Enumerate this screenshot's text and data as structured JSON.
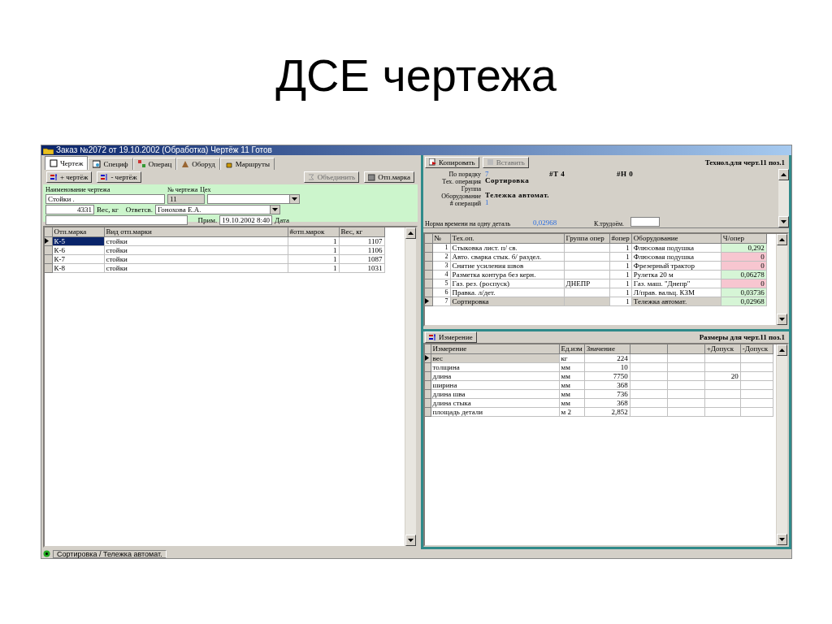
{
  "slide_title": "ДСЕ чертежа",
  "window": {
    "title": "Заказ №2072 от 19.10.2002 (Обработка) Чертёж 11 Готов"
  },
  "tabs": [
    {
      "label": "Чертеж",
      "selected": true
    },
    {
      "label": "Специф",
      "selected": false
    },
    {
      "label": "Операц",
      "selected": false
    },
    {
      "label": "Оборуд",
      "selected": false
    },
    {
      "label": "Маршруты",
      "selected": false
    }
  ],
  "left_toolbar": [
    {
      "label": "+ чертёж",
      "disabled": false
    },
    {
      "label": "- чертёж",
      "disabled": false
    },
    {
      "label": "Объединить",
      "disabled": true
    },
    {
      "label": "Отп.марка",
      "disabled": false
    }
  ],
  "drawing_form": {
    "name_label": "Наименование чертежа",
    "name_value": "Стойки .",
    "number_label": "№ чертежа",
    "number_value": "11",
    "shop_label": "Цех",
    "weight_value": "4331",
    "weight_label": "Вес, кг",
    "responsible_label": "Ответсв.",
    "responsible_value": "Гонохова Е.А.",
    "note_label": "Прим.",
    "date_value": "19.10.2002 8:40",
    "date_label": "Дата"
  },
  "marks_table": {
    "columns": [
      "Отп.марка",
      "Вид отп.марки",
      "#отп.марок",
      "Вес, кг"
    ],
    "rows": [
      {
        "cells": [
          "К-5",
          "стойки",
          "1",
          "1107"
        ],
        "selected": true
      },
      {
        "cells": [
          "К-6",
          "стойки",
          "1",
          "1106"
        ],
        "selected": false
      },
      {
        "cells": [
          "К-7",
          "стойки",
          "1",
          "1087"
        ],
        "selected": false
      },
      {
        "cells": [
          "К-8",
          "стойки",
          "1",
          "1031"
        ],
        "selected": false
      }
    ]
  },
  "right_toolbar": {
    "buttons": [
      {
        "label": "Копировать",
        "disabled": false
      },
      {
        "label": "Вставить",
        "disabled": true
      }
    ],
    "caption": "Технол.для черт.11 поз.1"
  },
  "operation_details": {
    "order_label": "По порядку",
    "order_value": "7",
    "t_label": "#Т",
    "t_value": "4",
    "h_label": "#Н",
    "h_value": "0",
    "op_label": "Тех. операция",
    "op_value": "Сортировка",
    "group_label": "Группа",
    "equipment_label": "Оборудование",
    "equipment_value": "Тележка автомат.",
    "count_label": "# операций",
    "count_value": "1",
    "norm_label": "Норма времени на одну деталь",
    "norm_value": "0,02968",
    "labor_label": "К.трудоём."
  },
  "operations_table": {
    "columns": [
      "№",
      "Тех.оп.",
      "Группа опер",
      "#опер",
      "Оборудование",
      "Ч/опер"
    ],
    "rows": [
      {
        "cells": [
          "1",
          "Стыковка лист.  п/ св.",
          "",
          "1",
          "Флюсовая подушка",
          "0,292"
        ],
        "color": "#d6f5d6",
        "selected": false
      },
      {
        "cells": [
          "2",
          "Авто. сварка стык. б/ раздел.",
          "",
          "1",
          "Флюсовая подушка",
          "0"
        ],
        "color": "#f7c6d0",
        "selected": false
      },
      {
        "cells": [
          "3",
          "Снятие усиления швов",
          "",
          "1",
          "Фрезерный трактор",
          "0"
        ],
        "color": "#f7c6d0",
        "selected": false
      },
      {
        "cells": [
          "4",
          "Разметка контура без керн.",
          "",
          "1",
          "Рулетка 20 м",
          "0,06278"
        ],
        "color": "#d6f5d6",
        "selected": false
      },
      {
        "cells": [
          "5",
          "Газ. рез. (роспуск)",
          "ДНЕПР",
          "1",
          "Газ. маш. \"Днепр\"",
          "0"
        ],
        "color": "#f7c6d0",
        "selected": false
      },
      {
        "cells": [
          "6",
          "Правка. л/дет.",
          "",
          "1",
          "Л/прав. вальц. КЗМ",
          "0,03736"
        ],
        "color": "#d6f5d6",
        "selected": false
      },
      {
        "cells": [
          "7",
          "Сортировка",
          "",
          "1",
          "Тележка автомат.",
          "0,02968"
        ],
        "color": "#d6f5d6",
        "selected": true
      }
    ]
  },
  "dimensions_toolbar": {
    "button": "Измерение",
    "caption": "Размеры для черт.11 поз.1"
  },
  "dimensions_table": {
    "columns": {
      "measure": "Измерение",
      "unit": "Ед.изм",
      "value": "Значение",
      "plus": "+Допуск",
      "minus": "-Допуск"
    },
    "rows": [
      {
        "measure": "вес",
        "unit": "кг",
        "value": "224",
        "selected": true
      },
      {
        "measure": "толщина",
        "unit": "мм",
        "value": "10",
        "selected": false
      },
      {
        "measure": "длина",
        "unit": "мм",
        "value": "7750",
        "plus": "20",
        "selected": false
      },
      {
        "measure": "ширина",
        "unit": "мм",
        "value": "368",
        "selected": false
      },
      {
        "measure": "длина  шва",
        "unit": "мм",
        "value": "736",
        "selected": false
      },
      {
        "measure": "длина стыка",
        "unit": "мм",
        "value": "368",
        "selected": false
      },
      {
        "measure": "площадь детали",
        "unit": "м 2",
        "value": "2,852",
        "selected": false
      }
    ]
  },
  "status_bar": {
    "text": "Сортировка / Тележка автомат."
  }
}
